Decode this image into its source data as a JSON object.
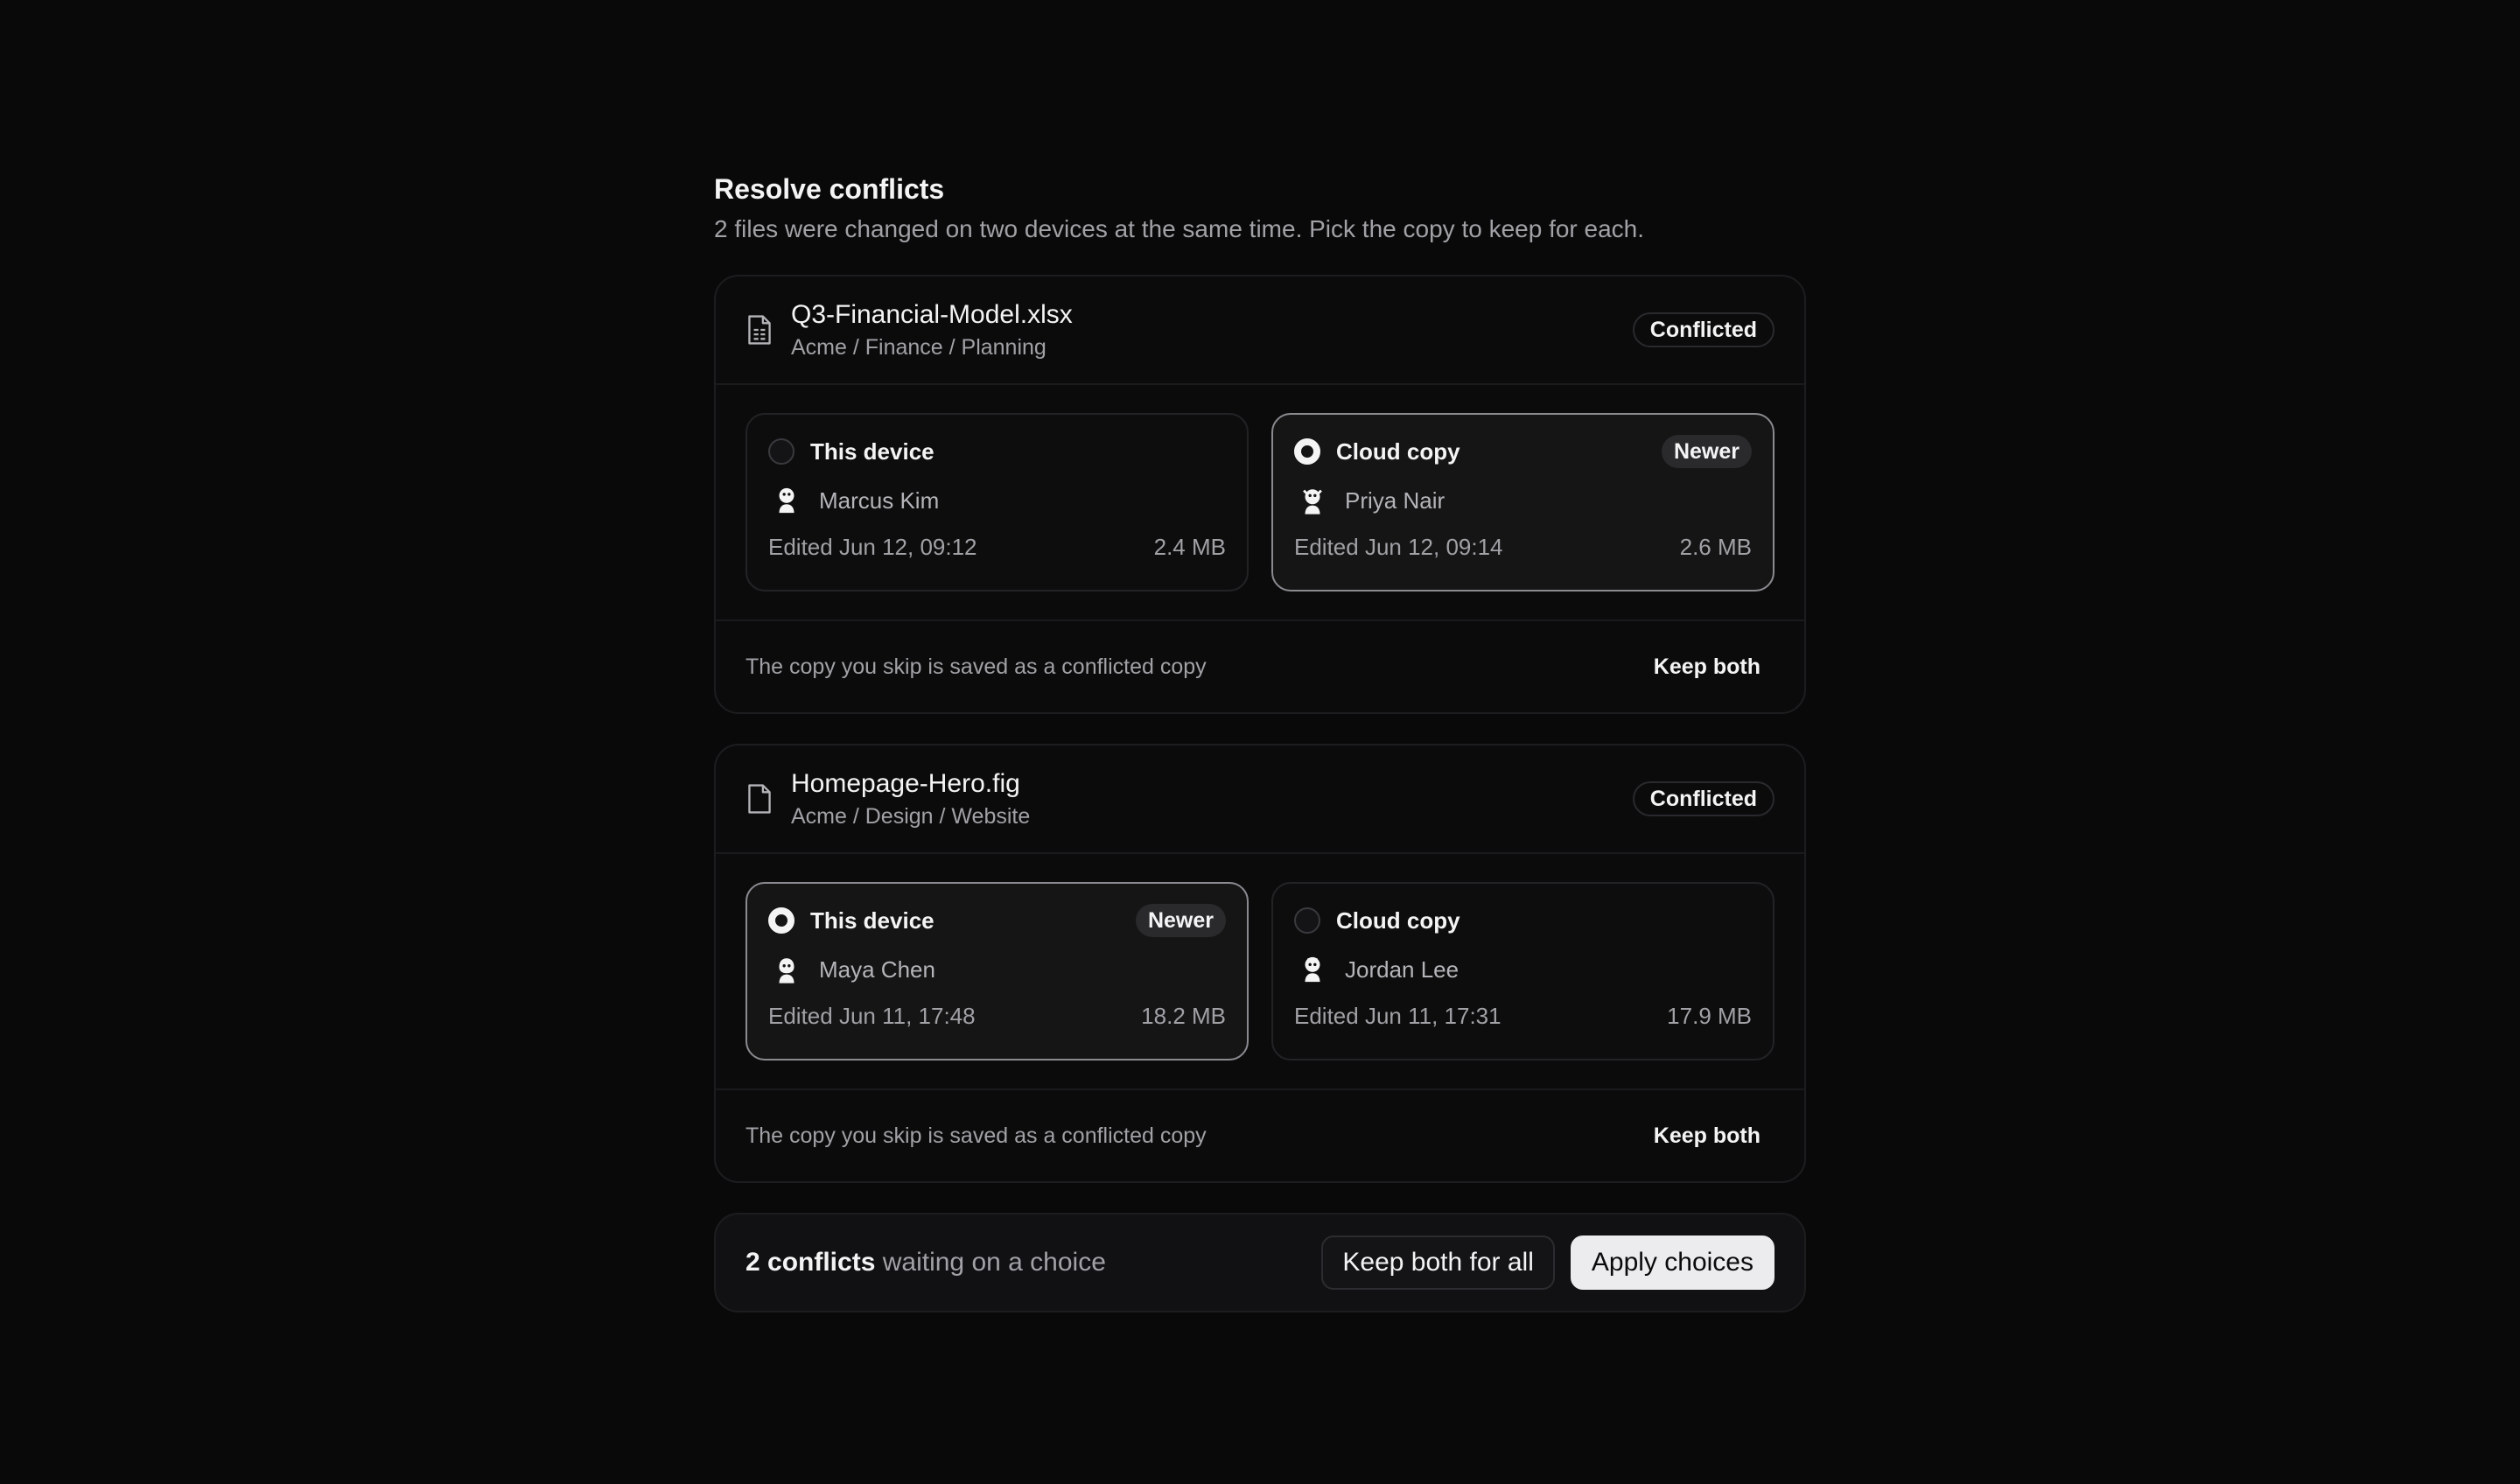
{
  "header": {
    "title": "Resolve conflicts",
    "subtitle": "2 files were changed on two devices at the same time. Pick the copy to keep for each."
  },
  "files": [
    {
      "name": "Q3-Financial-Model.xlsx",
      "path": "Acme / Finance / Planning",
      "icon": "spreadsheet-file-icon",
      "status": "Conflicted",
      "selected": "cloud",
      "options": [
        {
          "label": "This device",
          "user": "Marcus Kim",
          "edited": "Edited Jun 12, 09:12",
          "size": "2.4 MB",
          "badge": ""
        },
        {
          "label": "Cloud copy",
          "user": "Priya Nair",
          "edited": "Edited Jun 12, 09:14",
          "size": "2.6 MB",
          "badge": "Newer"
        }
      ],
      "note": "The copy you skip is saved as a conflicted copy",
      "keep_both": "Keep both"
    },
    {
      "name": "Homepage-Hero.fig",
      "path": "Acme / Design / Website",
      "icon": "document-file-icon",
      "status": "Conflicted",
      "selected": "device",
      "options": [
        {
          "label": "This device",
          "user": "Maya Chen",
          "edited": "Edited Jun 11, 17:48",
          "size": "18.2 MB",
          "badge": "Newer"
        },
        {
          "label": "Cloud copy",
          "user": "Jordan Lee",
          "edited": "Edited Jun 11, 17:31",
          "size": "17.9 MB",
          "badge": ""
        }
      ],
      "note": "The copy you skip is saved as a conflicted copy",
      "keep_both": "Keep both"
    }
  ],
  "summary": {
    "count": "2 conflicts",
    "text": "waiting on a choice",
    "keep_all": "Keep both for all",
    "apply": "Apply choices"
  }
}
